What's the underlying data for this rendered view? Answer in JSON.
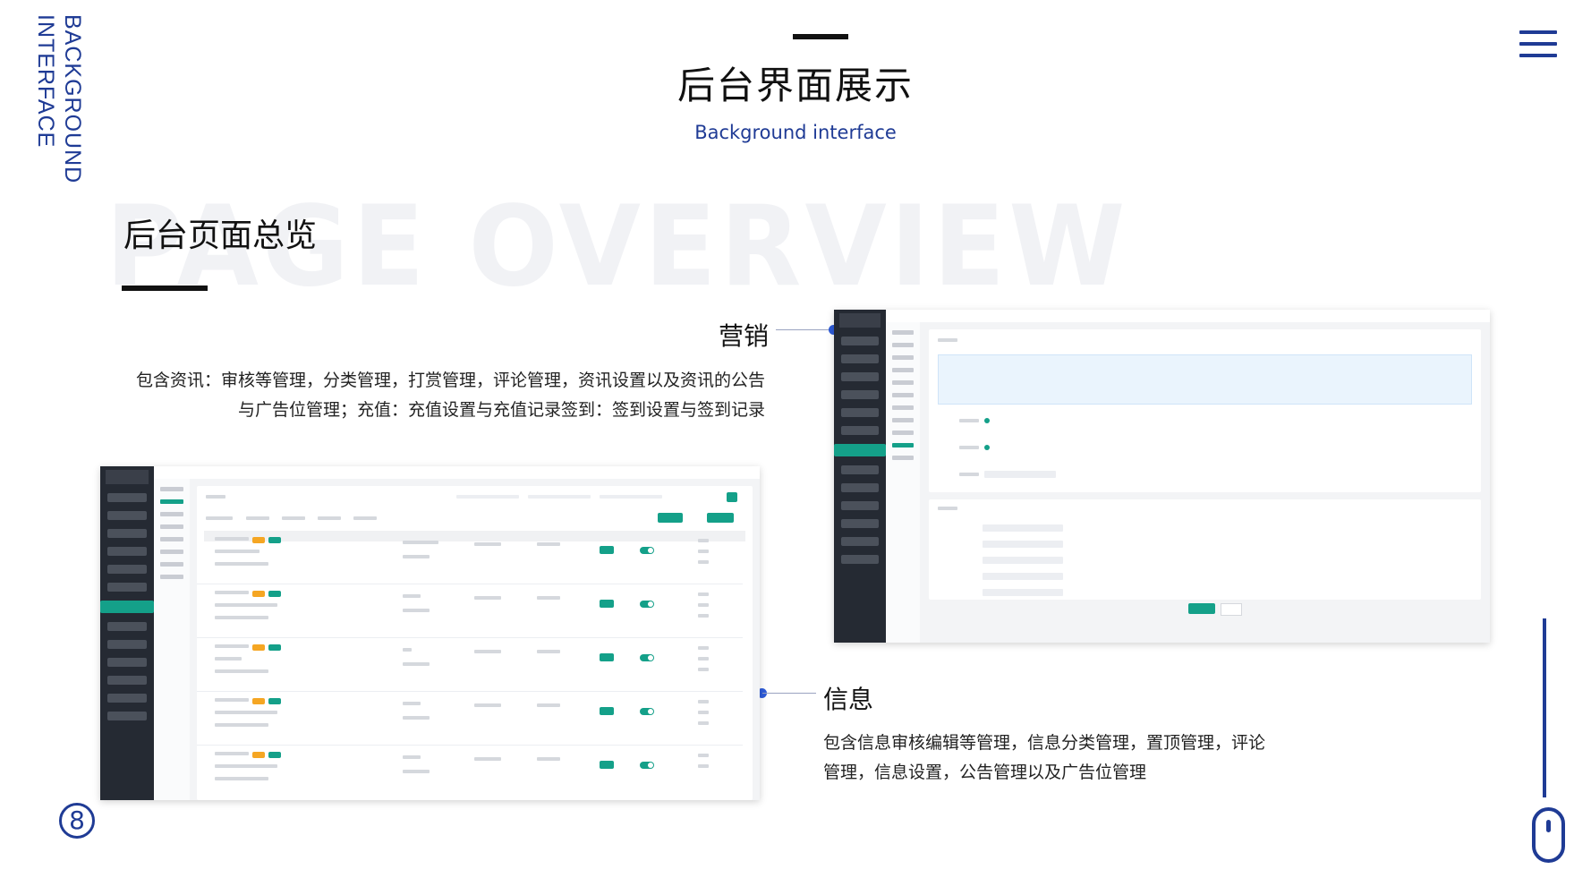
{
  "side_title": {
    "line1": "BACKGROUND",
    "line2": "INTERFACE"
  },
  "header": {
    "title": "后台界面展示",
    "subtitle": "Background interface"
  },
  "overview": {
    "watermark": "PAGE OVERVIEW",
    "title": "后台页面总览"
  },
  "marketing": {
    "title": "营销",
    "line1": "包含资讯：审核等管理，分类管理，打赏管理，评论管理，资讯设置以及资讯的公告",
    "line2": "与广告位管理；充值：充值设置与充值记录签到：签到设置与签到记录"
  },
  "info": {
    "title": "信息",
    "line1": "包含信息审核编辑等管理，信息分类管理，置顶管理，评论",
    "line2": "管理，信息设置，公告管理以及广告位管理"
  },
  "page_number": "8",
  "icons": [
    "menu-icon",
    "mouse-scroll-icon"
  ],
  "colors": {
    "accent": "#1f3b95",
    "dot": "#2e5bd8",
    "admin_green": "#14a089",
    "admin_sidebar": "#252a33"
  }
}
